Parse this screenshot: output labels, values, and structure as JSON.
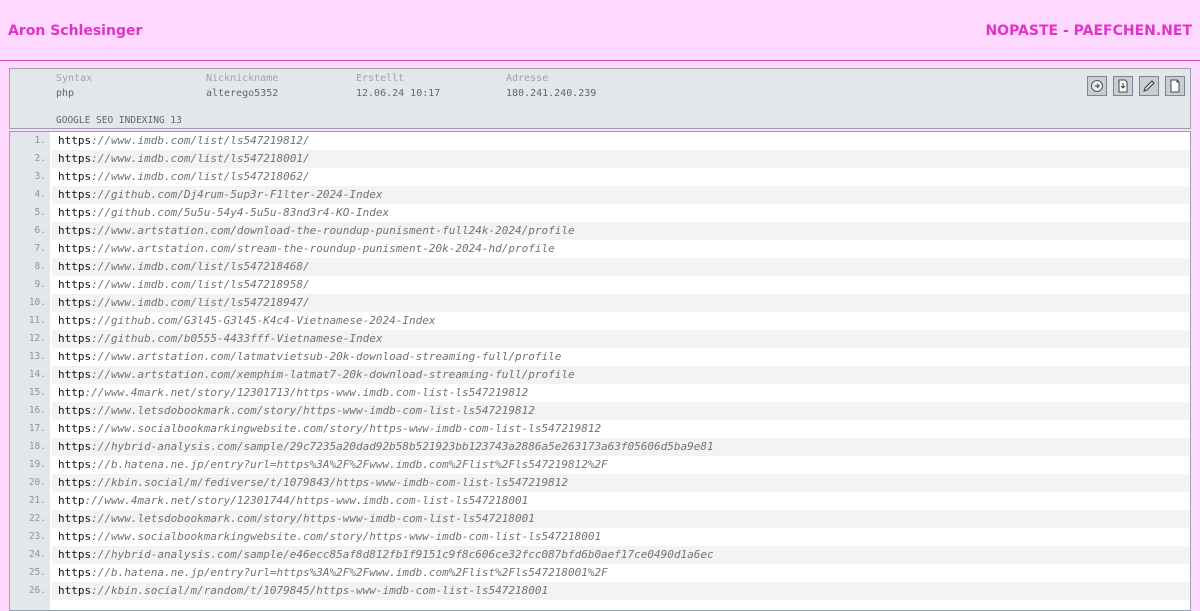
{
  "header": {
    "author": "Aron Schlesinger",
    "site": "NOPASTE - PAEFCHEN.NET"
  },
  "meta": {
    "syntax_label": "Syntax",
    "syntax": "php",
    "nick_label": "Nicknickname",
    "nick": "alterego5352",
    "created_label": "Erstellt",
    "created": "12.06.24 10:17",
    "address_label": "Adresse",
    "address": "180.241.240.239",
    "title": "GOOGLE SEO INDEXING 13"
  },
  "actions": [
    {
      "icon": "circle-arrow-icon"
    },
    {
      "icon": "download-file-icon"
    },
    {
      "icon": "pencil-edit-icon"
    },
    {
      "icon": "blank-page-icon"
    }
  ],
  "lines": [
    {
      "n": "1.",
      "p": "https",
      "r": "://www.imdb.com/list/ls547219812/"
    },
    {
      "n": "2.",
      "p": "https",
      "r": "://www.imdb.com/list/ls547218001/"
    },
    {
      "n": "3.",
      "p": "https",
      "r": "://www.imdb.com/list/ls547218062/"
    },
    {
      "n": "4.",
      "p": "https",
      "r": "://github.com/Dj4rum-5up3r-F1lter-2024-Index"
    },
    {
      "n": "5.",
      "p": "https",
      "r": "://github.com/5u5u-54y4-5u5u-83nd3r4-KO-Index"
    },
    {
      "n": "6.",
      "p": "https",
      "r": "://www.artstation.com/download-the-roundup-punisment-full24k-2024/profile"
    },
    {
      "n": "7.",
      "p": "https",
      "r": "://www.artstation.com/stream-the-roundup-punisment-20k-2024-hd/profile"
    },
    {
      "n": "8.",
      "p": "https",
      "r": "://www.imdb.com/list/ls547218468/"
    },
    {
      "n": "9.",
      "p": "https",
      "r": "://www.imdb.com/list/ls547218958/"
    },
    {
      "n": "10.",
      "p": "https",
      "r": "://www.imdb.com/list/ls547218947/"
    },
    {
      "n": "11.",
      "p": "https",
      "r": "://github.com/G3l45-G3l45-K4c4-Vietnamese-2024-Index"
    },
    {
      "n": "12.",
      "p": "https",
      "r": "://github.com/b0555-4433fff-Vietnamese-Index"
    },
    {
      "n": "13.",
      "p": "https",
      "r": "://www.artstation.com/latmatvietsub-20k-download-streaming-full/profile"
    },
    {
      "n": "14.",
      "p": "https",
      "r": "://www.artstation.com/xemphim-latmat7-20k-download-streaming-full/profile"
    },
    {
      "n": "15.",
      "p": "http",
      "r": "://www.4mark.net/story/12301713/https-www.imdb.com-list-ls547219812"
    },
    {
      "n": "16.",
      "p": "https",
      "r": "://www.letsdobookmark.com/story/https-www-imdb-com-list-ls547219812"
    },
    {
      "n": "17.",
      "p": "https",
      "r": "://www.socialbookmarkingwebsite.com/story/https-www-imdb-com-list-ls547219812"
    },
    {
      "n": "18.",
      "p": "https",
      "r": "://hybrid-analysis.com/sample/29c7235a20dad92b58b521923bb123743a2886a5e263173a63f05606d5ba9e81"
    },
    {
      "n": "19.",
      "p": "https",
      "r": "://b.hatena.ne.jp/entry?url=https%3A%2F%2Fwww.imdb.com%2Flist%2Fls547219812%2F"
    },
    {
      "n": "20.",
      "p": "https",
      "r": "://kbin.social/m/fediverse/t/1079843/https-www-imdb-com-list-ls547219812"
    },
    {
      "n": "21.",
      "p": "http",
      "r": "://www.4mark.net/story/12301744/https-www.imdb.com-list-ls547218001"
    },
    {
      "n": "22.",
      "p": "https",
      "r": "://www.letsdobookmark.com/story/https-www-imdb-com-list-ls547218001"
    },
    {
      "n": "23.",
      "p": "https",
      "r": "://www.socialbookmarkingwebsite.com/story/https-www-imdb-com-list-ls547218001"
    },
    {
      "n": "24.",
      "p": "https",
      "r": "://hybrid-analysis.com/sample/e46ecc85af8d812fb1f9151c9f8c606ce32fcc087bfd6b0aef17ce0490d1a6ec"
    },
    {
      "n": "25.",
      "p": "https",
      "r": "://b.hatena.ne.jp/entry?url=https%3A%2F%2Fwww.imdb.com%2Flist%2Fls547218001%2F"
    },
    {
      "n": "26.",
      "p": "https",
      "r": "://kbin.social/m/random/t/1079845/https-www-imdb-com-list-ls547218001"
    }
  ]
}
